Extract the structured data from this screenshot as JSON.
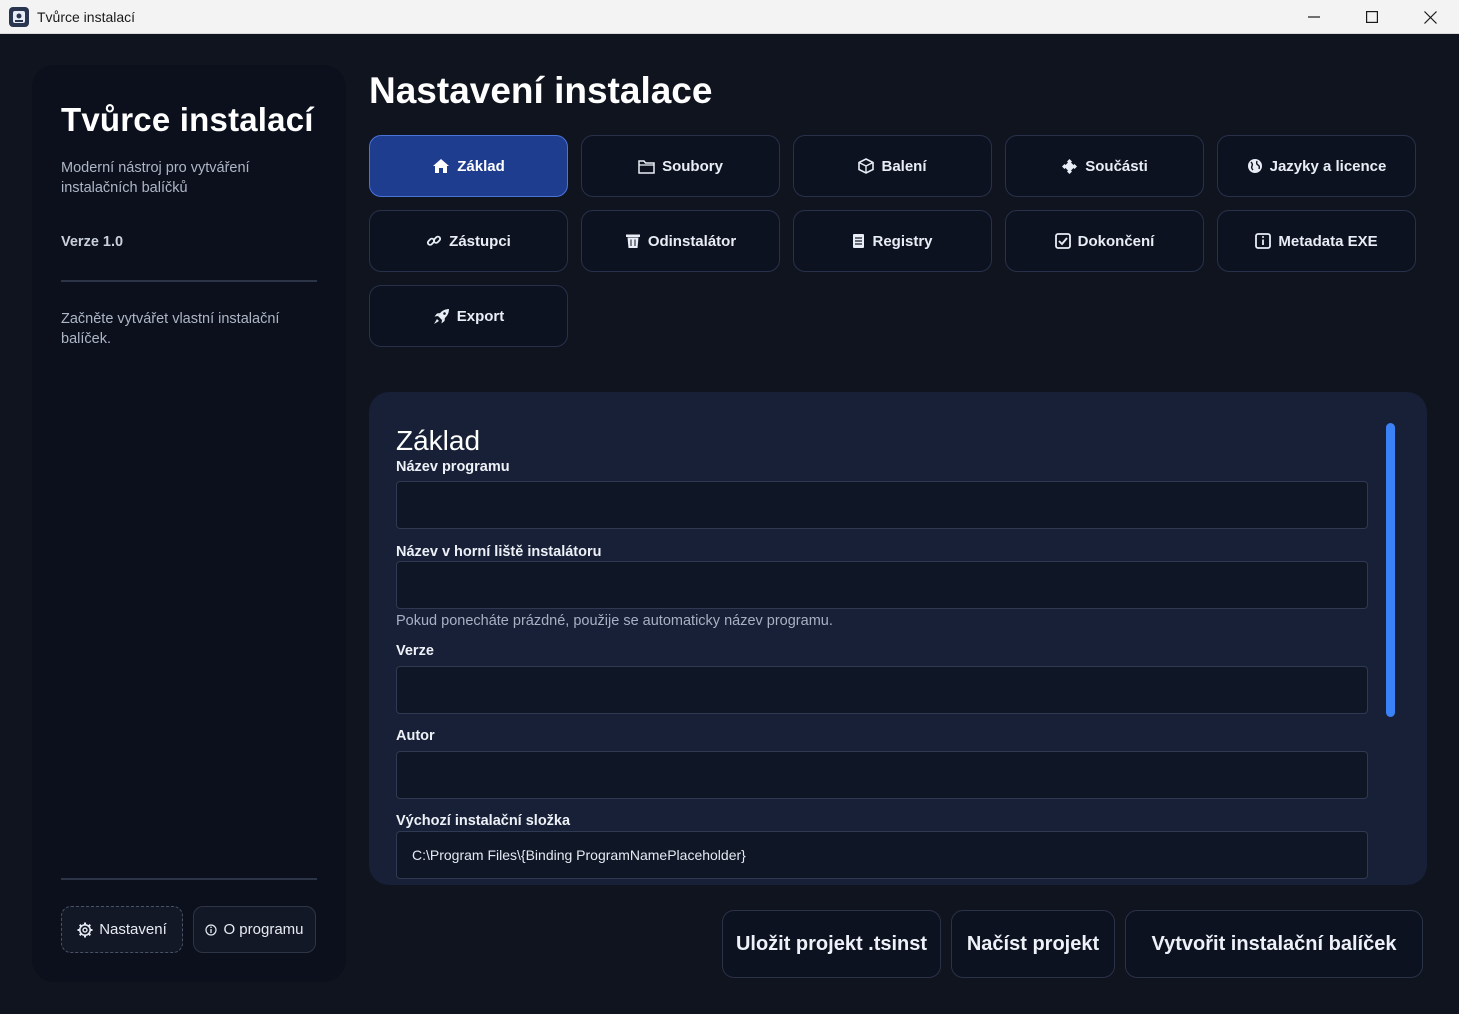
{
  "window": {
    "title": "Tvůrce instalací"
  },
  "sidebar": {
    "title": "Tvůrce instalací",
    "description": "Moderní nástroj pro vytváření instalačních balíčků",
    "version": "Verze 1.0",
    "start_text": "Začněte vytvářet vlastní instalační balíček.",
    "settings_label": "Nastavení",
    "about_label": "O programu"
  },
  "main": {
    "title": "Nastavení instalace",
    "tabs": [
      {
        "label": "Základ",
        "icon": "home-icon",
        "active": true
      },
      {
        "label": "Soubory",
        "icon": "folder-icon",
        "active": false
      },
      {
        "label": "Balení",
        "icon": "package-icon",
        "active": false
      },
      {
        "label": "Součásti",
        "icon": "puzzle-icon",
        "active": false
      },
      {
        "label": "Jazyky a licence",
        "icon": "globe-icon",
        "active": false
      },
      {
        "label": "Zástupci",
        "icon": "link-icon",
        "active": false
      },
      {
        "label": "Odinstalátor",
        "icon": "trash-icon",
        "active": false
      },
      {
        "label": "Registry",
        "icon": "document-icon",
        "active": false
      },
      {
        "label": "Dokončení",
        "icon": "checkbox-icon",
        "active": false
      },
      {
        "label": "Metadata EXE",
        "icon": "info-icon",
        "active": false
      },
      {
        "label": "Export",
        "icon": "rocket-icon",
        "active": false
      }
    ]
  },
  "form": {
    "section_title": "Základ",
    "program_name_label": "Název programu",
    "program_name_value": "",
    "titlebar_name_label": "Název v horní liště instalátoru",
    "titlebar_name_value": "",
    "titlebar_name_hint": "Pokud ponecháte prázdné, použije se automaticky název programu.",
    "version_label": "Verze",
    "version_value": "",
    "author_label": "Autor",
    "author_value": "",
    "install_folder_label": "Výchozí instalační složka",
    "install_folder_value": "C:\\Program Files\\{Binding ProgramNamePlaceholder}"
  },
  "actions": {
    "save_label": "Uložit projekt .tsinst",
    "load_label": "Načíst projekt",
    "build_label": "Vytvořit instalační balíček"
  },
  "colors": {
    "accent": "#3b82f6",
    "active_tab": "#1f3d8f",
    "background": "#10141f",
    "card": "#172036"
  }
}
